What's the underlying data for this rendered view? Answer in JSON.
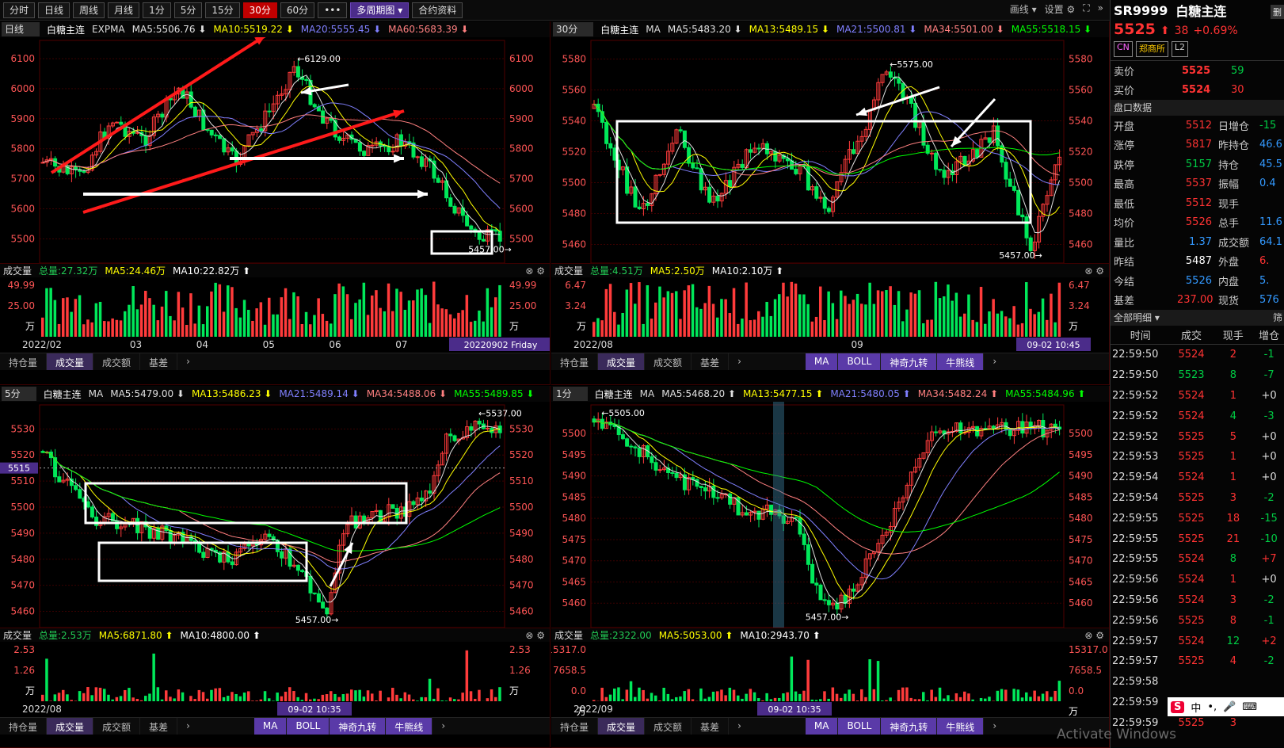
{
  "toolbar": {
    "buttons": [
      {
        "label": "分时"
      },
      {
        "label": "日线"
      },
      {
        "label": "周线"
      },
      {
        "label": "月线"
      },
      {
        "label": "1分"
      },
      {
        "label": "5分"
      },
      {
        "label": "15分"
      },
      {
        "label": "30分",
        "active": true
      },
      {
        "label": "60分"
      },
      {
        "label": "•••"
      },
      {
        "label": "多周期图 ▾",
        "purple": true
      },
      {
        "label": "合约资料"
      }
    ],
    "draw": "画线 ▾",
    "settings": "设置"
  },
  "panes": [
    {
      "timeframe": "日线",
      "name": "白糖主连",
      "ind": "EXPMA",
      "ma": [
        {
          "t": "MA5:5506.76 ⬇",
          "c": "#e0e0e0"
        },
        {
          "t": "MA10:5519.22 ⬇",
          "c": "#ffff00"
        },
        {
          "t": "MA20:5555.45 ⬇",
          "c": "#8080ff"
        },
        {
          "t": "MA60:5683.39 ⬇",
          "c": "#ff8080"
        }
      ],
      "chart_data": {
        "type": "candlestick",
        "yticks": [
          6100,
          6000,
          5900,
          5800,
          5700,
          5600,
          5500
        ],
        "ylim": [
          5430,
          6150
        ],
        "high_label": "6129.00",
        "low_label": "5457.00"
      },
      "vol": {
        "title": "成交量",
        "total": "总量:27.32万",
        "ma5": "MA5:24.46万",
        "ma10": "MA10:22.82万 ⬆",
        "yt": [
          "49.99",
          "25.00",
          "万"
        ],
        "xlabels": [
          "2022/02",
          "03",
          "04",
          "05",
          "06",
          "07",
          "08"
        ],
        "cursor": "20220902 Friday"
      },
      "tabs": [
        "持仓量",
        "成交量",
        "成交额",
        "基差"
      ],
      "mtabs": []
    },
    {
      "timeframe": "30分",
      "name": "白糖主连",
      "ind": "MA",
      "ma": [
        {
          "t": "MA5:5483.20 ⬇",
          "c": "#e0e0e0"
        },
        {
          "t": "MA13:5489.15 ⬇",
          "c": "#ffff00"
        },
        {
          "t": "MA21:5500.81 ⬇",
          "c": "#8080ff"
        },
        {
          "t": "MA34:5501.00 ⬇",
          "c": "#ff8080"
        },
        {
          "t": "MA55:5518.15 ⬇",
          "c": "#00ff00"
        }
      ],
      "chart_data": {
        "type": "candlestick",
        "yticks": [
          5580,
          5560,
          5540,
          5520,
          5500,
          5480,
          5460
        ],
        "ylim": [
          5450,
          5590
        ],
        "high_label": "5575.00",
        "low_label": "5457.00"
      },
      "vol": {
        "title": "成交量",
        "total": "总量:4.51万",
        "ma5": "MA5:2.50万",
        "ma10": "MA10:2.10万 ⬆",
        "yt": [
          "6.47",
          "3.24",
          "万"
        ],
        "xlabels": [
          "2022/08",
          "09"
        ],
        "cursor": "09-02 10:45"
      },
      "tabs": [
        "持仓量",
        "成交量",
        "成交额",
        "基差"
      ],
      "mtabs": [
        "MA",
        "BOLL",
        "神奇九转",
        "牛熊线"
      ]
    },
    {
      "timeframe": "5分",
      "name": "白糖主连",
      "ind": "MA",
      "ma": [
        {
          "t": "MA5:5479.00 ⬇",
          "c": "#e0e0e0"
        },
        {
          "t": "MA13:5486.23 ⬇",
          "c": "#ffff00"
        },
        {
          "t": "MA21:5489.14 ⬇",
          "c": "#8080ff"
        },
        {
          "t": "MA34:5488.06 ⬇",
          "c": "#ff8080"
        },
        {
          "t": "MA55:5489.85 ⬇",
          "c": "#00ff00"
        }
      ],
      "chart_data": {
        "type": "candlestick",
        "yticks": [
          5530,
          5520,
          5510,
          5500,
          5490,
          5480,
          5470,
          5460
        ],
        "ylim": [
          5455,
          5538
        ],
        "high_label": "5537.00",
        "low_label": "5457.00",
        "cross": "5515"
      },
      "vol": {
        "title": "成交量",
        "total": "总量:2.53万",
        "ma5": "MA5:6871.80 ⬆",
        "ma10": "MA10:4800.00 ⬆",
        "yt": [
          "2.53",
          "1.26",
          "万"
        ],
        "xlabels": [
          "2022/08"
        ],
        "cursor": "09-02 10:35"
      },
      "tabs": [
        "持仓量",
        "成交量",
        "成交额",
        "基差"
      ],
      "mtabs": [
        "MA",
        "BOLL",
        "神奇九转",
        "牛熊线"
      ]
    },
    {
      "timeframe": "1分",
      "name": "白糖主连",
      "ind": "MA",
      "ma": [
        {
          "t": "MA5:5468.20 ⬆",
          "c": "#e0e0e0"
        },
        {
          "t": "MA13:5477.15 ⬆",
          "c": "#ffff00"
        },
        {
          "t": "MA21:5480.05 ⬆",
          "c": "#8080ff"
        },
        {
          "t": "MA34:5482.24 ⬆",
          "c": "#ff8080"
        },
        {
          "t": "MA55:5484.96 ⬆",
          "c": "#00ff00"
        }
      ],
      "chart_data": {
        "type": "candlestick",
        "yticks": [
          5500,
          5495,
          5490,
          5485,
          5480,
          5475,
          5470,
          5465,
          5460
        ],
        "ylim": [
          5455,
          5506
        ],
        "high_label": "5505.00",
        "low_label": "5457.00"
      },
      "vol": {
        "title": "成交量",
        "total": "总量:2322.00",
        "ma5": "MA5:5053.00 ⬆",
        "ma10": "MA10:2943.70 ⬆",
        "yt": [
          "15317.0",
          "7658.5",
          "0.0",
          "万"
        ],
        "xlabels": [
          "2022/09"
        ],
        "cursor": "09-02 10:35"
      },
      "tabs": [
        "持仓量",
        "成交量",
        "成交额",
        "基差"
      ],
      "mtabs": [
        "MA",
        "BOLL",
        "神奇九转",
        "牛熊线"
      ]
    }
  ],
  "side": {
    "code": "SR9999",
    "name": "白糖主连",
    "price": "5525",
    "arrow": "⬆",
    "chg": "38",
    "pct": "+0.69%",
    "tags": [
      "CN",
      "郑商所",
      "L2"
    ],
    "corner": "删",
    "sell": {
      "l": "卖价",
      "p": "5525",
      "v": "59"
    },
    "buy": {
      "l": "买价",
      "p": "5524",
      "v": "30"
    },
    "pk": "盘口数据",
    "stats": [
      [
        "开盘",
        "5512",
        "日增仓",
        "-15"
      ],
      [
        "涨停",
        "5817",
        "昨持仓",
        "46.6"
      ],
      [
        "跌停",
        "5157",
        "持仓",
        "45.5"
      ],
      [
        "最高",
        "5537",
        "振幅",
        "0.4"
      ],
      [
        "最低",
        "5512",
        "现手",
        ""
      ],
      [
        "均价",
        "5526",
        "总手",
        "11.6"
      ],
      [
        "量比",
        "1.37",
        "成交额",
        "64.1"
      ],
      [
        "昨结",
        "5487",
        "外盘",
        "6."
      ],
      [
        "今结",
        "5526",
        "内盘",
        "5."
      ],
      [
        "基差",
        "237.00",
        "现货",
        "576"
      ]
    ],
    "detail": "全部明细 ▾",
    "detail_r": "筛",
    "cols": [
      "时间",
      "成交",
      "现手",
      "增仓"
    ],
    "ticks": [
      [
        "22:59:50",
        "5524",
        "2",
        "-1"
      ],
      [
        "22:59:50",
        "5523",
        "8",
        "-7"
      ],
      [
        "22:59:52",
        "5524",
        "1",
        "+0"
      ],
      [
        "22:59:52",
        "5524",
        "4",
        "-3"
      ],
      [
        "22:59:52",
        "5525",
        "5",
        "+0"
      ],
      [
        "22:59:53",
        "5525",
        "1",
        "+0"
      ],
      [
        "22:59:54",
        "5524",
        "1",
        "+0"
      ],
      [
        "22:59:54",
        "5525",
        "3",
        "-2"
      ],
      [
        "22:59:55",
        "5525",
        "18",
        "-15"
      ],
      [
        "22:59:55",
        "5525",
        "21",
        "-10"
      ],
      [
        "22:59:55",
        "5524",
        "8",
        "+7"
      ],
      [
        "22:59:56",
        "5524",
        "1",
        "+0"
      ],
      [
        "22:59:56",
        "5524",
        "3",
        "-2"
      ],
      [
        "22:59:56",
        "5525",
        "8",
        "-1"
      ],
      [
        "22:59:57",
        "5524",
        "12",
        "+2"
      ],
      [
        "22:59:57",
        "5525",
        "4",
        "-2"
      ],
      [
        "22:59:58",
        "",
        "",
        ""
      ],
      [
        "22:59:59",
        "5525",
        "2",
        "-1"
      ],
      [
        "22:59:59",
        "5525",
        "3",
        ""
      ]
    ]
  },
  "watermark": "Activate Windows"
}
